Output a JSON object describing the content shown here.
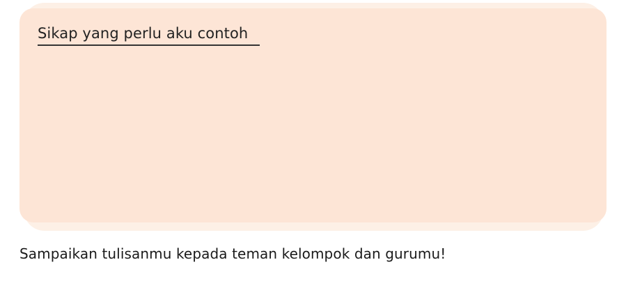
{
  "box": {
    "title": "Sikap yang perlu aku contoh"
  },
  "instruction": "Sampaikan tulisanmu kepada teman kelompok dan gurumu!",
  "colors": {
    "box_fill": "#fde5d6",
    "box_glow": "#fdf0e6"
  }
}
